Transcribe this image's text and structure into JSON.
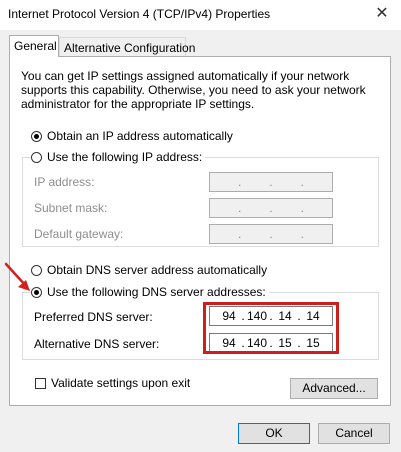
{
  "window": {
    "title": "Internet Protocol Version 4 (TCP/IPv4) Properties",
    "close_glyph": "✕"
  },
  "tabs": [
    {
      "label": "General",
      "active": true
    },
    {
      "label": "Alternative Configuration",
      "active": false
    }
  ],
  "description": "You can get IP settings assigned automatically if your network supports this capability. Otherwise, you need to ask your network administrator for the appropriate IP settings.",
  "ip_section": {
    "auto_label": "Obtain an IP address automatically",
    "auto_selected": true,
    "manual_label": "Use the following IP address:",
    "manual_selected": false,
    "fields": [
      {
        "label": "IP address:",
        "value": [
          "",
          "",
          "",
          ""
        ]
      },
      {
        "label": "Subnet mask:",
        "value": [
          "",
          "",
          "",
          ""
        ]
      },
      {
        "label": "Default gateway:",
        "value": [
          "",
          "",
          "",
          ""
        ]
      }
    ]
  },
  "dns_section": {
    "auto_label": "Obtain DNS server address automatically",
    "auto_selected": false,
    "manual_label": "Use the following DNS server addresses:",
    "manual_selected": true,
    "preferred": {
      "label": "Preferred DNS server:",
      "octets": [
        "94",
        "140",
        "14",
        "14"
      ]
    },
    "alternate": {
      "label": "Alternative DNS server:",
      "octets": [
        "94",
        "140",
        "15",
        "15"
      ]
    }
  },
  "validate": {
    "label": "Validate settings upon exit",
    "checked": false
  },
  "buttons": {
    "advanced": "Advanced...",
    "ok": "OK",
    "cancel": "Cancel"
  },
  "colors": {
    "highlight": "#cc1f1f",
    "arrow": "#d61f1f",
    "focus_border": "#0078d7"
  }
}
